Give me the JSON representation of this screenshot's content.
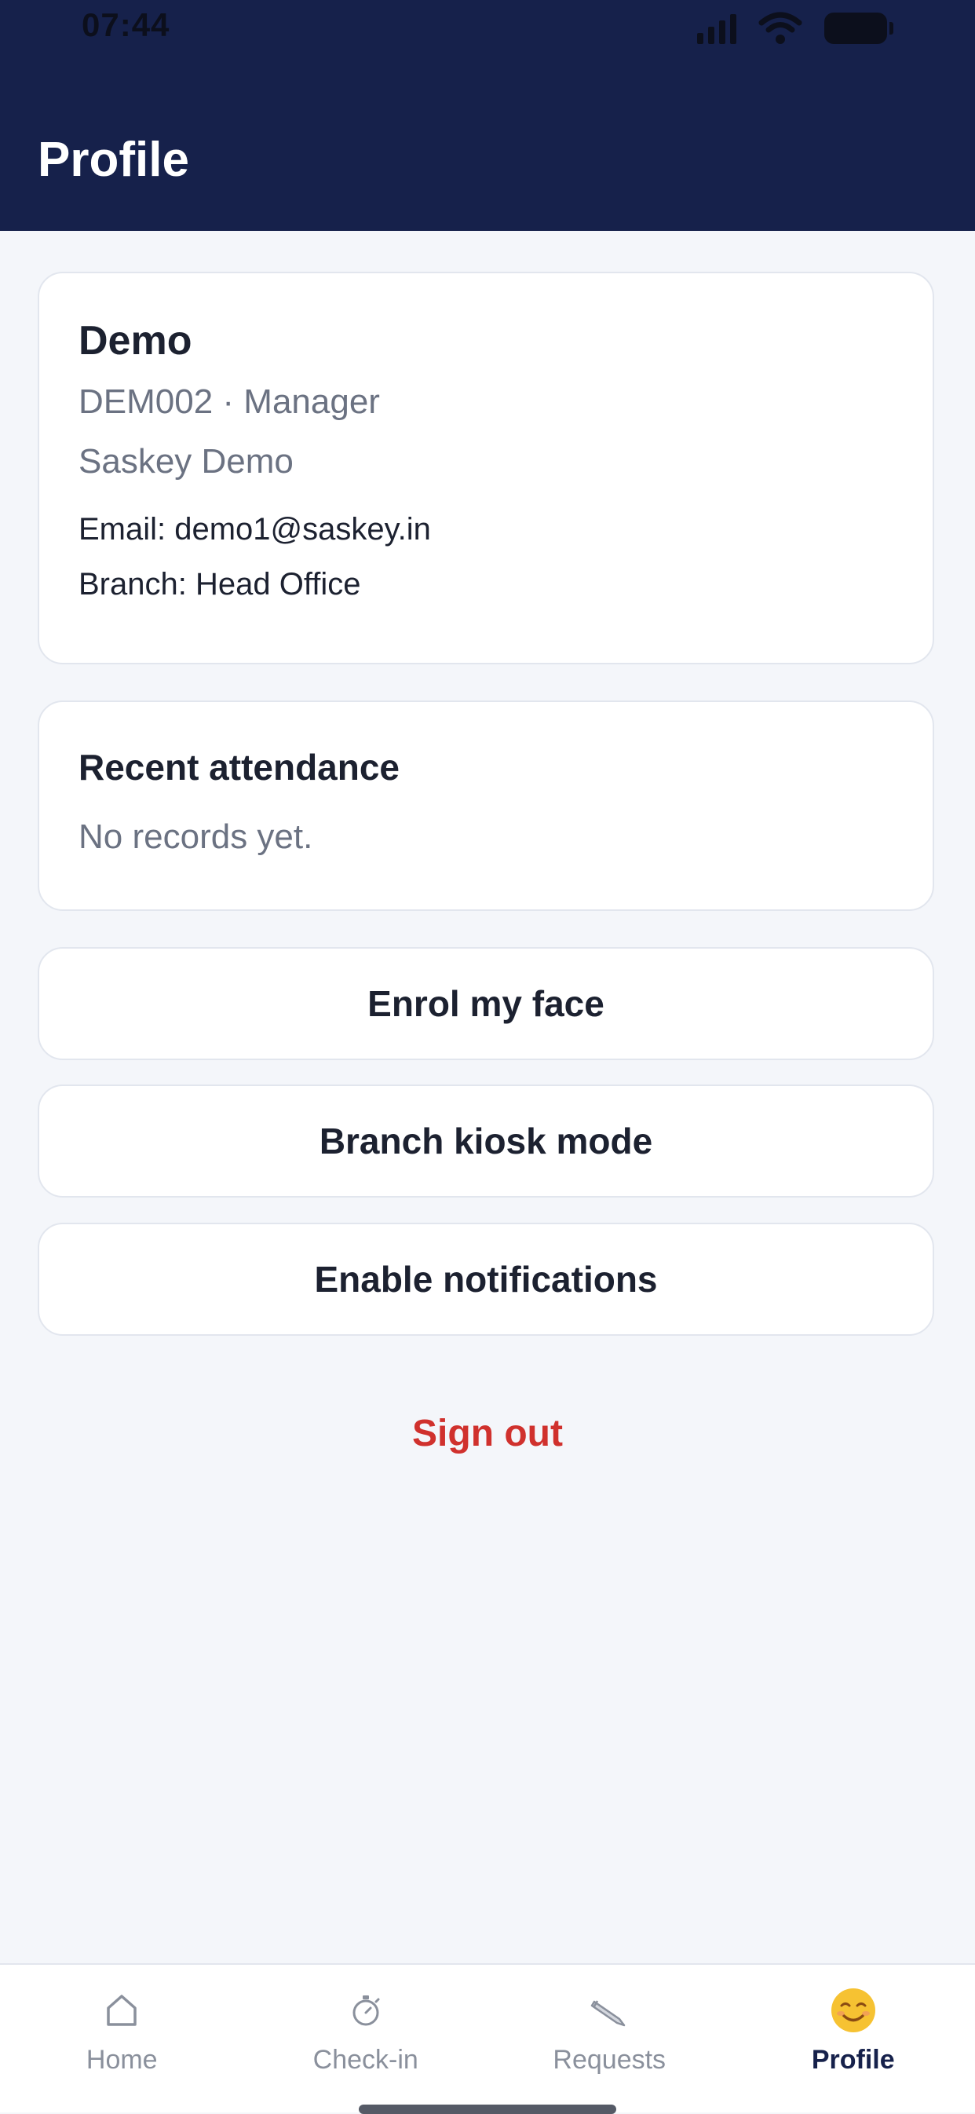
{
  "status_bar": {
    "time": "07:44",
    "icons": [
      "signal-icon",
      "wifi-icon",
      "battery-icon"
    ]
  },
  "header": {
    "title": "Profile"
  },
  "profile": {
    "name": "Demo",
    "id_role": "DEM002 · Manager",
    "organization": "Saskey Demo",
    "email": "Email: demo1@saskey.in",
    "branch": "Branch: Head Office"
  },
  "attendance": {
    "title": "Recent attendance",
    "empty": "No records yet."
  },
  "actions": {
    "enrol_face": "Enrol my face",
    "kiosk_mode": "Branch kiosk mode",
    "notifications": "Enable notifications",
    "sign_out": "Sign out"
  },
  "tabs": [
    {
      "label": "Home",
      "icon": "home-icon"
    },
    {
      "label": "Check-in",
      "icon": "stopwatch-icon"
    },
    {
      "label": "Requests",
      "icon": "pencil-icon"
    },
    {
      "label": "Profile",
      "icon": "smiley-icon"
    }
  ],
  "colors": {
    "header": "#16214b",
    "sign_out": "#d0312d",
    "background": "#f4f6fa"
  }
}
